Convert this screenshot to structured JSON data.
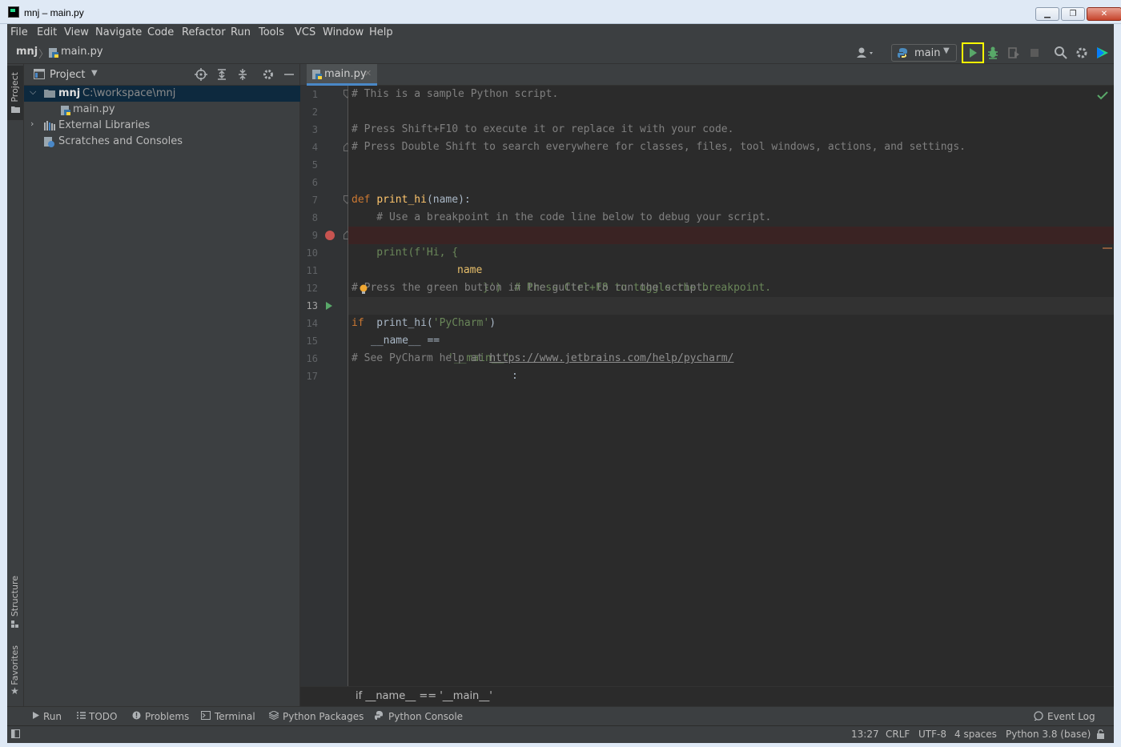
{
  "window": {
    "title": "mnj – main.py"
  },
  "menu": [
    "File",
    "Edit",
    "View",
    "Navigate",
    "Code",
    "Refactor",
    "Run",
    "Tools",
    "VCS",
    "Window",
    "Help"
  ],
  "nav": {
    "project": "mnj",
    "file": "main.py",
    "run_config": "main"
  },
  "project_panel": {
    "title": "Project",
    "tree": {
      "root_name": "mnj",
      "root_path": "C:\\workspace\\mnj",
      "file": "main.py",
      "external_libraries": "External Libraries",
      "scratches": "Scratches and Consoles"
    }
  },
  "side_tabs": {
    "project": "Project",
    "structure": "Structure",
    "favorites": "Favorites"
  },
  "editor": {
    "tab": "main.py",
    "breadcrumb": "if __name__ == '__main__'",
    "line_numbers": [
      "1",
      "2",
      "3",
      "4",
      "5",
      "6",
      "7",
      "8",
      "9",
      "10",
      "11",
      "12",
      "13",
      "14",
      "15",
      "16",
      "17"
    ],
    "lines": {
      "l1": "# This is a sample Python script.",
      "l3": "# Press Shift+F10 to execute it or replace it with your code.",
      "l4": "# Press Double Shift to search everywhere for classes, files, tool windows, actions, and settings.",
      "l7_kw": "def ",
      "l7_fn": "print_hi",
      "l7_rest": "(name):",
      "l8": "    # Use a breakpoint in the code line below to debug your script.",
      "l9_a": "    print(f'Hi, {",
      "l9_b": "name",
      "l9_c": "}')  # Press Ctrl+F8 to toggle the breakpoint.",
      "l12": "# Press the green button in the gutter to run the script.",
      "l13_kw": "if ",
      "l13_id": "__name__ == ",
      "l13_str": "'__main__'",
      "l13_end": ":",
      "l14_a": "    print_hi(",
      "l14_str": "'PyCharm'",
      "l14_end": ")",
      "l16_a": "# See PyCharm help at ",
      "l16_link": "https://www.jetbrains.com/help/pycharm/"
    }
  },
  "tool_windows": [
    "Run",
    "TODO",
    "Problems",
    "Terminal",
    "Python Packages",
    "Python Console"
  ],
  "event_log": "Event Log",
  "status": {
    "position": "13:27",
    "line_sep": "CRLF",
    "encoding": "UTF-8",
    "indent": "4 spaces",
    "interpreter": "Python 3.8 (base)"
  },
  "colors": {
    "accent": "#4a88c7",
    "run": "#59a869",
    "breakpoint": "#c75450",
    "highlight": "#ffff00"
  }
}
